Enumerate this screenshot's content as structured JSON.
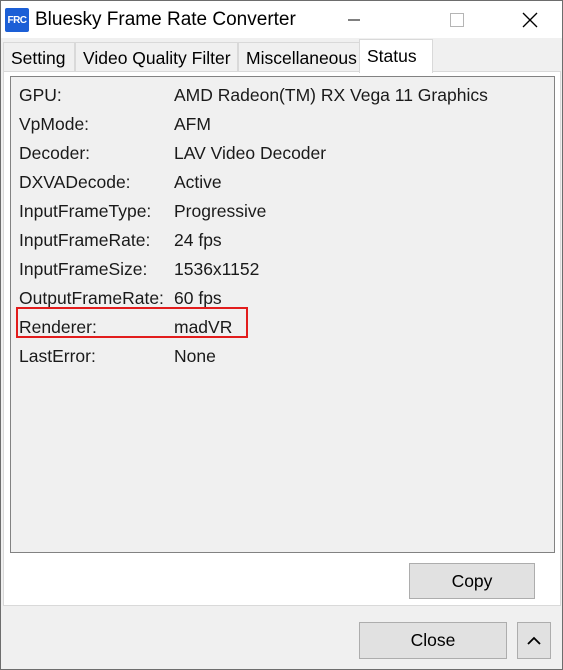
{
  "window": {
    "icon_text": "FRC",
    "title": "Bluesky Frame Rate Converter"
  },
  "tabs": [
    {
      "label": "Setting",
      "active": false
    },
    {
      "label": "Video Quality Filter",
      "active": false
    },
    {
      "label": "Miscellaneous",
      "active": false
    },
    {
      "label": "Status",
      "active": true
    }
  ],
  "status_rows": [
    {
      "key": "GPU:",
      "value": "AMD Radeon(TM) RX Vega 11 Graphics"
    },
    {
      "key": "VpMode:",
      "value": "AFM"
    },
    {
      "key": "Decoder:",
      "value": "LAV Video Decoder"
    },
    {
      "key": "DXVADecode:",
      "value": "Active"
    },
    {
      "key": "InputFrameType:",
      "value": "Progressive"
    },
    {
      "key": "InputFrameRate:",
      "value": "24 fps"
    },
    {
      "key": "InputFrameSize:",
      "value": "1536x1152"
    },
    {
      "key": "OutputFrameRate:",
      "value": "60 fps"
    },
    {
      "key": "Renderer:",
      "value": "madVR"
    },
    {
      "key": "LastError:",
      "value": "None"
    }
  ],
  "buttons": {
    "copy": "Copy",
    "close": "Close"
  },
  "colors": {
    "highlight": "#e21c1c",
    "icon_bg": "#1c5fd6"
  }
}
